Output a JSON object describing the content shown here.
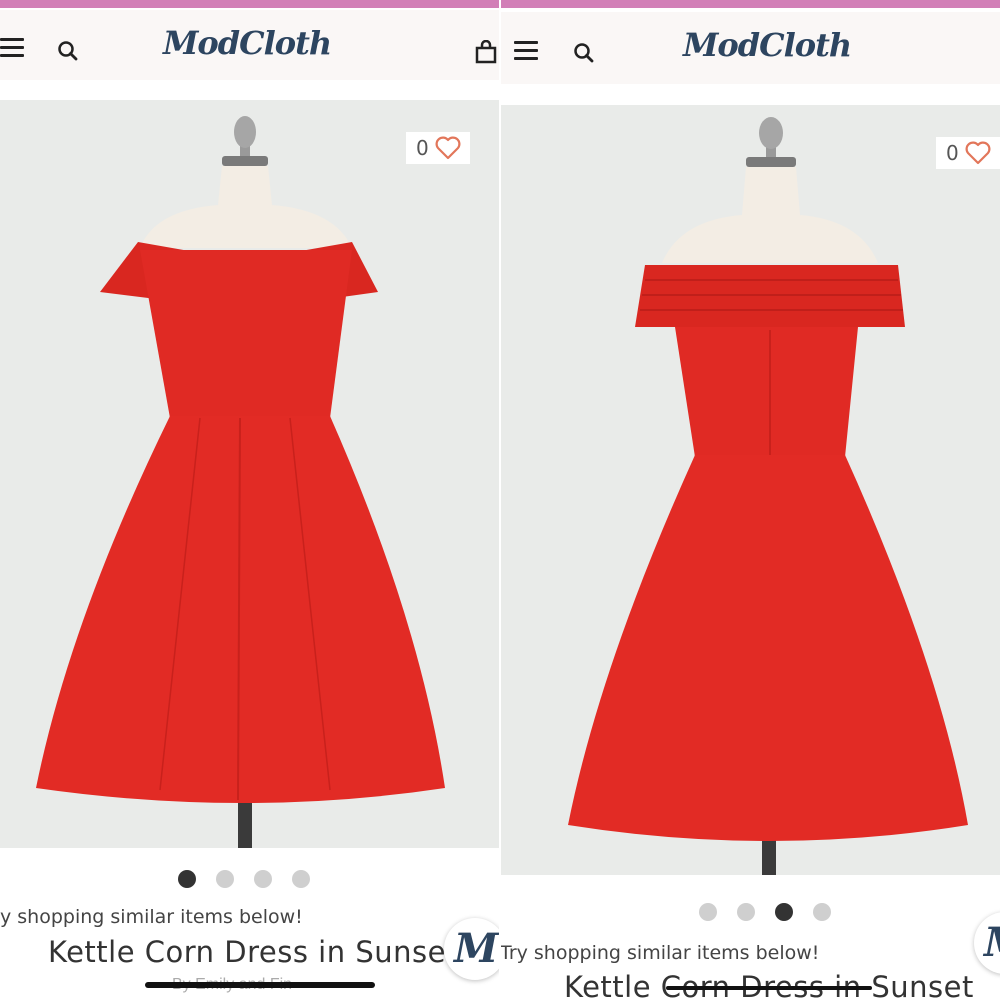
{
  "colors": {
    "top_strip": "#d27fb7",
    "brand_navy": "#2d4560",
    "dress_red": "#e02a24",
    "photo_bg": "#e9ebe9",
    "dot_active": "#333333",
    "dot_inactive": "#cfcfcf",
    "heart": "#e2765a"
  },
  "icons": {
    "menu": "hamburger-icon",
    "search": "search-icon",
    "bag": "shopping-bag-icon",
    "wishlist": "heart-icon",
    "chat": "modcloth-m-icon"
  },
  "left": {
    "brand": "ModCloth",
    "wishlist_count": "0",
    "carousel": {
      "total": 4,
      "active": 1
    },
    "similar_text": "y shopping similar items below!",
    "product_title": "Kettle Corn Dress in Sunset",
    "byline": "By Emily and Fin",
    "badge_letter": "M"
  },
  "right": {
    "brand": "ModCloth",
    "wishlist_count": "0",
    "carousel": {
      "total": 4,
      "active": 3
    },
    "similar_text": "Try shopping similar items below!",
    "product_title": "Kettle Corn Dress in Sunset",
    "badge_letter": "M"
  }
}
